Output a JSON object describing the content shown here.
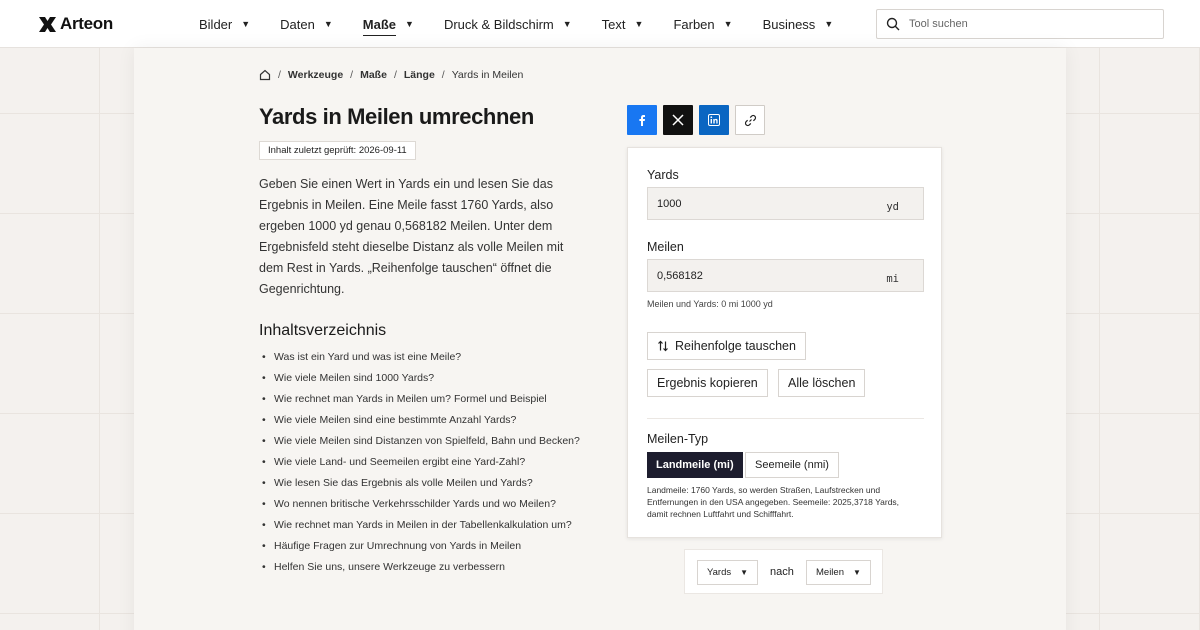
{
  "brand": {
    "name": "Arteon"
  },
  "nav": [
    {
      "label": "Bilder",
      "active": false
    },
    {
      "label": "Daten",
      "active": false
    },
    {
      "label": "Maße",
      "active": true
    },
    {
      "label": "Druck & Bildschirm",
      "active": false
    },
    {
      "label": "Text",
      "active": false
    },
    {
      "label": "Farben",
      "active": false
    },
    {
      "label": "Business",
      "active": false
    }
  ],
  "search": {
    "placeholder": "Tool suchen"
  },
  "breadcrumb": [
    "Werkzeuge",
    "Maße",
    "Länge",
    "Yards in Meilen"
  ],
  "page": {
    "title": "Yards in Meilen umrechnen",
    "updated": "Inhalt zuletzt geprüft: 2026-09-11",
    "intro": "Geben Sie einen Wert in Yards ein und lesen Sie das Ergebnis in Meilen. Eine Meile fasst 1760 Yards, also ergeben 1000 yd genau 0,568182 Meilen. Unter dem Ergebnisfeld steht dieselbe Distanz als volle Meilen mit dem Rest in Yards. „Reihenfolge tauschen“ öffnet die Gegenrichtung."
  },
  "toc": {
    "heading": "Inhaltsverzeichnis",
    "items": [
      "Was ist ein Yard und was ist eine Meile?",
      "Wie viele Meilen sind 1000 Yards?",
      "Wie rechnet man Yards in Meilen um? Formel und Beispiel",
      "Wie viele Meilen sind eine bestimmte Anzahl Yards?",
      "Wie viele Meilen sind Distanzen von Spielfeld, Bahn und Becken?",
      "Wie viele Land- und Seemeilen ergibt eine Yard-Zahl?",
      "Wie lesen Sie das Ergebnis als volle Meilen und Yards?",
      "Wo nennen britische Verkehrsschilder Yards und wo Meilen?",
      "Wie rechnet man Yards in Meilen in der Tabellenkalkulation um?",
      "Häufige Fragen zur Umrechnung von Yards in Meilen",
      "Helfen Sie uns, unsere Werkzeuge zu verbessern"
    ]
  },
  "share": {
    "icons": [
      "facebook-icon",
      "x-icon",
      "linkedin-icon",
      "link-icon"
    ],
    "colors": {
      "facebook": "#1877f2",
      "x": "#111111",
      "linkedin": "#0a66c2"
    }
  },
  "converter": {
    "from_label": "Yards",
    "from_value": "1000",
    "from_unit": "yd",
    "to_label": "Meilen",
    "to_value": "0,568182",
    "to_unit": "mi",
    "hint": "Meilen und Yards: 0 mi 1000 yd",
    "swap_label": "Reihenfolge tauschen",
    "copy_label": "Ergebnis kopieren",
    "clear_label": "Alle löschen",
    "type_heading": "Meilen-Typ",
    "type_land": "Landmeile (mi)",
    "type_sea": "Seemeile (nmi)",
    "type_note": "Landmeile: 1760 Yards, so werden Straßen, Laufstrecken und Entfernungen in den USA angegeben. Seemeile: 2025,3718 Yards, damit rechnen Luftfahrt und Schifffahrt."
  },
  "direction": {
    "from": "Yards",
    "connector": "nach",
    "to": "Meilen"
  }
}
